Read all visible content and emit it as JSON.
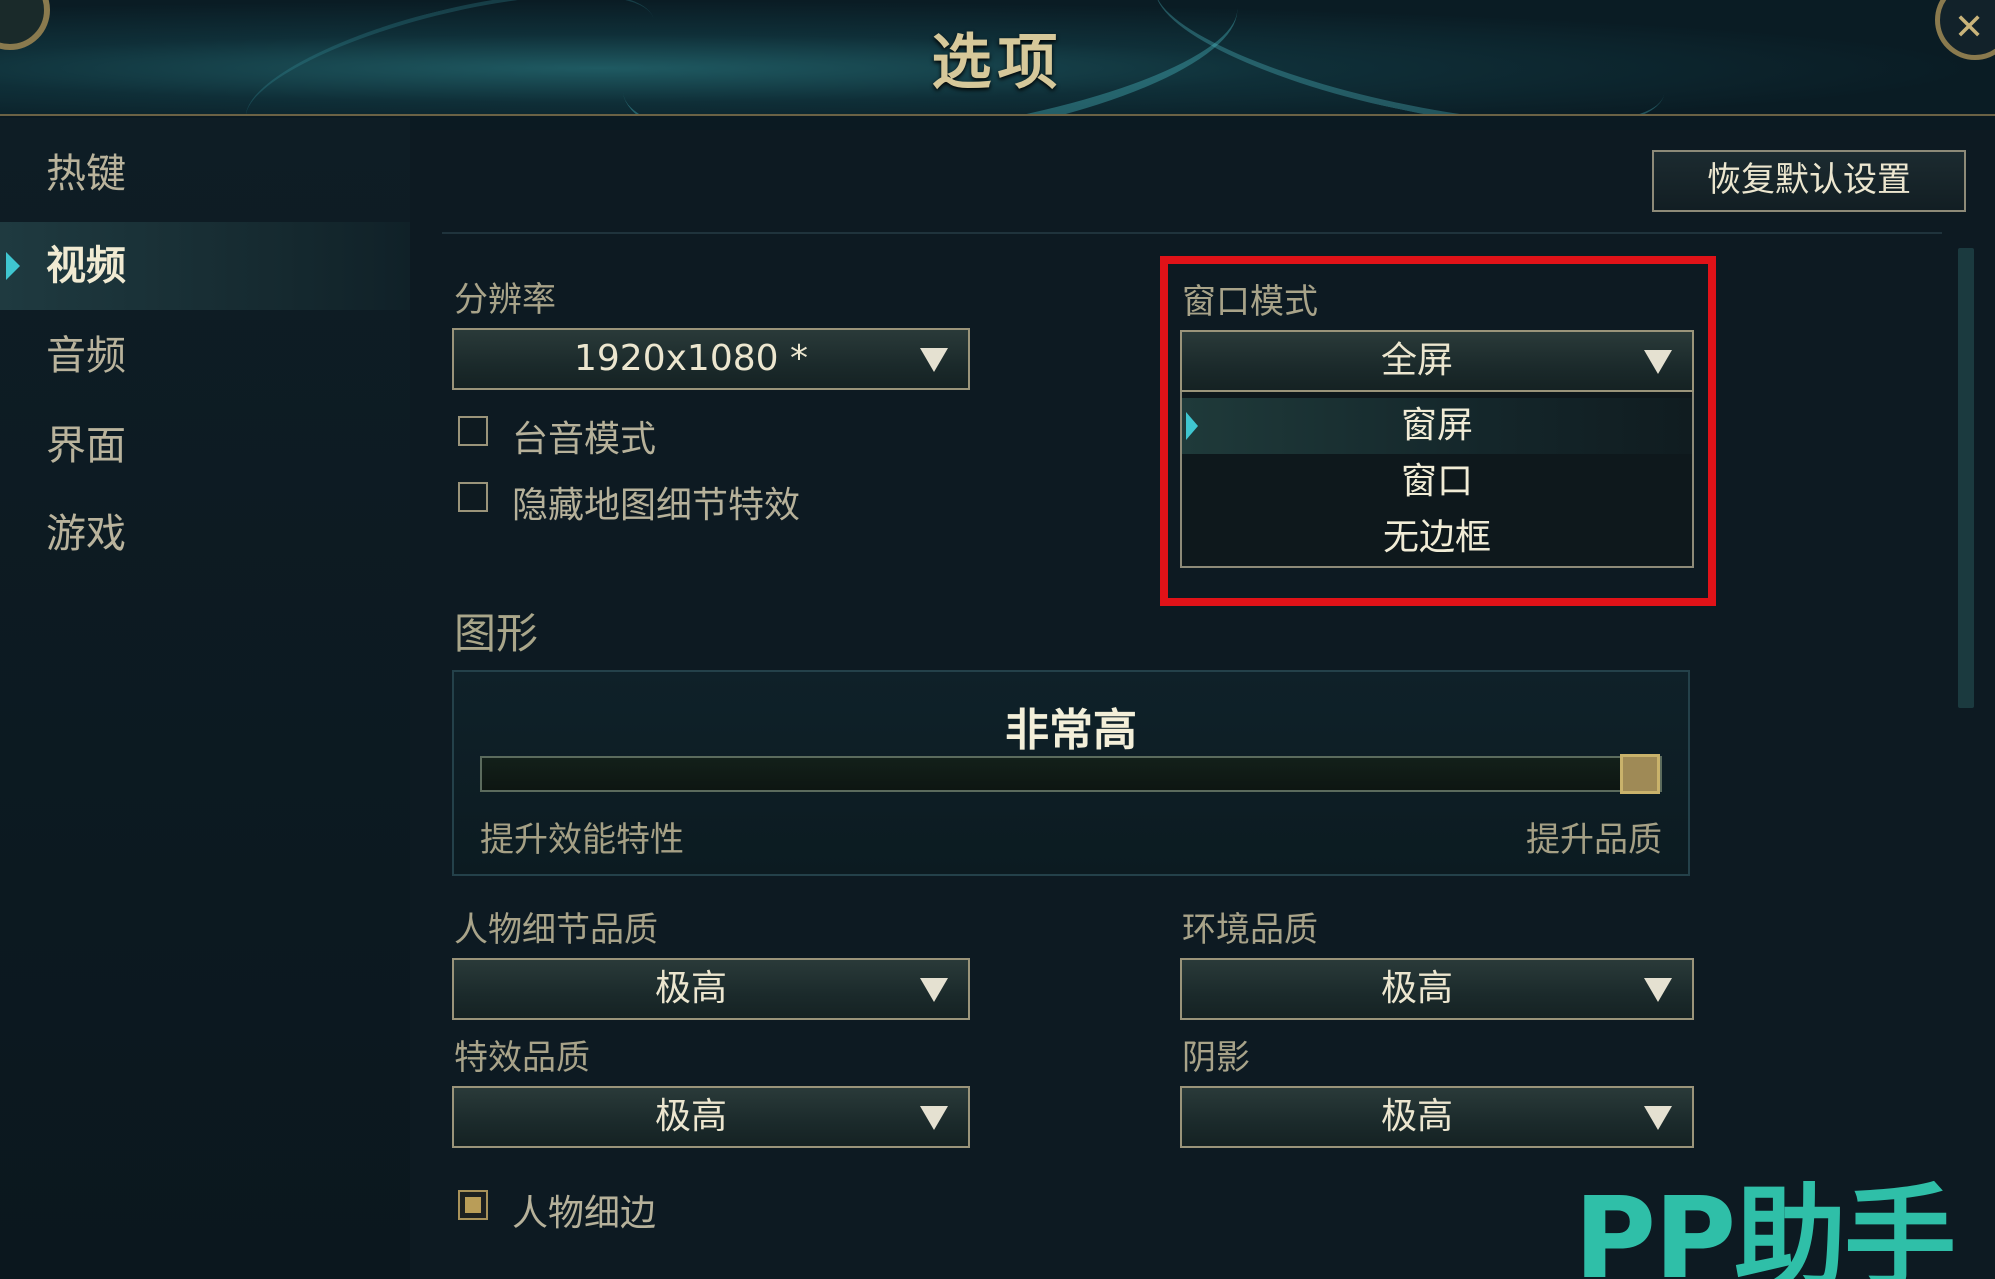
{
  "header": {
    "title": "选项"
  },
  "sidebar": {
    "items": [
      {
        "label": "热键"
      },
      {
        "label": "视频",
        "active": true
      },
      {
        "label": "音频"
      },
      {
        "label": "界面"
      },
      {
        "label": "游戏"
      }
    ]
  },
  "toolbar": {
    "reset_label": "恢复默认设置"
  },
  "resolution": {
    "label": "分辨率",
    "value": "1920x1080 *"
  },
  "checkboxes": {
    "first": {
      "label": "台音模式",
      "checked": false
    },
    "second": {
      "label": "隐藏地图细节特效",
      "checked": false
    }
  },
  "window_mode": {
    "label": "窗口模式",
    "value": "全屏",
    "options": [
      "窗屏",
      "窗口",
      "无边框"
    ],
    "highlighted_index": 0
  },
  "graphics": {
    "title": "图形",
    "value": "非常高",
    "level_fraction": 1.0,
    "min_label": "提升效能特性",
    "max_label": "提升品质"
  },
  "quality": {
    "character": {
      "label": "人物细节品质",
      "value": "极高"
    },
    "environment": {
      "label": "环境品质",
      "value": "极高"
    },
    "effects": {
      "label": "特效品质",
      "value": "极高"
    },
    "shadows": {
      "label": "阴影",
      "value": "极高"
    }
  },
  "outline": {
    "label": "人物细边",
    "checked": true
  },
  "watermark": {
    "text": "PP助手"
  },
  "colors": {
    "highlight_box": "#e01218",
    "accent": "#3fc6d0",
    "gold": "#c9b26b"
  }
}
